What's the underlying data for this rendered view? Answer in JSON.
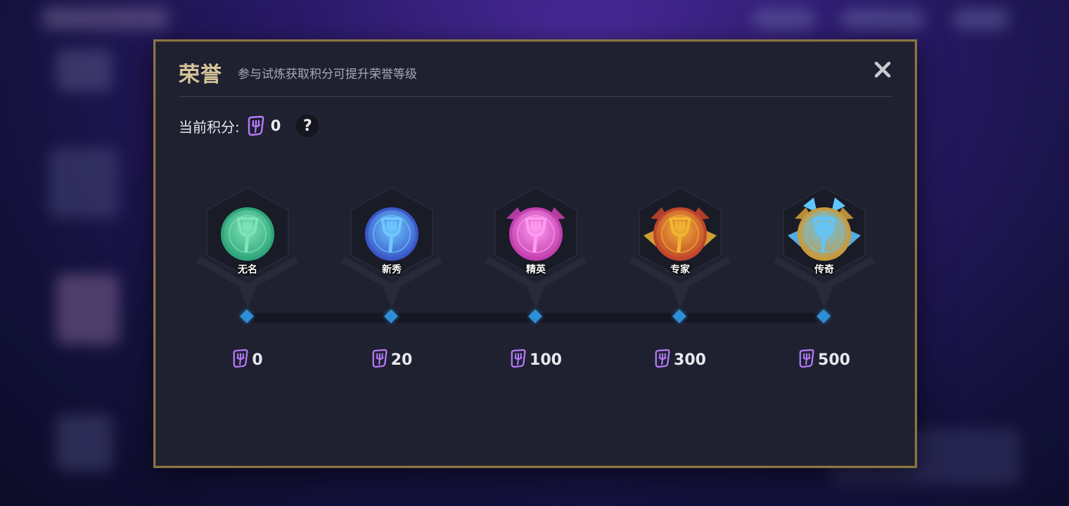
{
  "dialog": {
    "title": "荣誉",
    "subtitle": "参与试炼获取积分可提升荣誉等级",
    "close_icon": "close-icon"
  },
  "points": {
    "label": "当前积分:",
    "icon": "honor-point-icon",
    "value": "0",
    "help_label": "?"
  },
  "tiers": [
    {
      "name": "无名",
      "required": "0",
      "color": "#2fa67a",
      "accent": "#7fe3b8"
    },
    {
      "name": "新秀",
      "required": "20",
      "color": "#3a57c8",
      "accent": "#6ec8ff"
    },
    {
      "name": "精英",
      "required": "100",
      "color": "#c23fae",
      "accent": "#ff9af0"
    },
    {
      "name": "专家",
      "required": "300",
      "color": "#c0452c",
      "accent": "#f2b533"
    },
    {
      "name": "传奇",
      "required": "500",
      "color": "#c89a3c",
      "accent": "#5fc6ff"
    }
  ],
  "colors": {
    "accent_gold": "#d6c59a",
    "border_gold": "#8b7547",
    "panel_bg": "#1f2130",
    "node_blue": "#2f8fd6",
    "point_icon_purple": "#b77bff"
  }
}
